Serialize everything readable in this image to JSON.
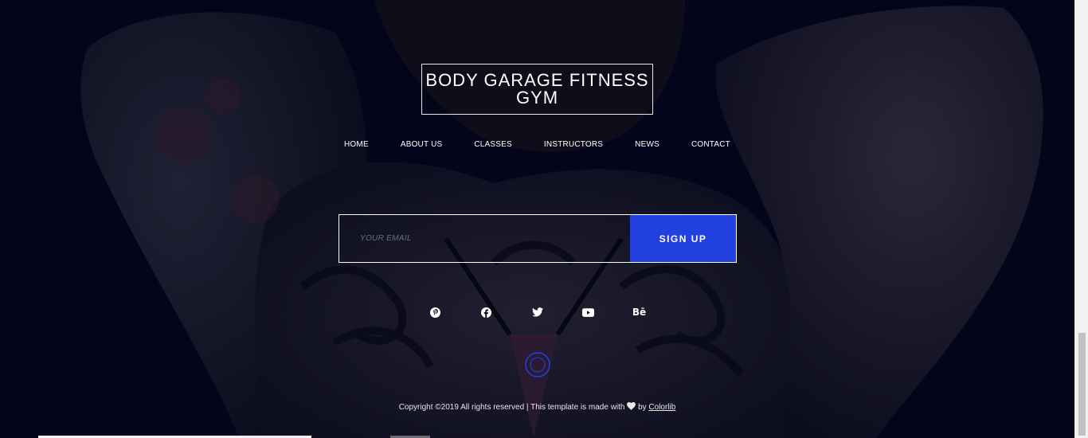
{
  "brand": {
    "title": "BODY GARAGE FITNESS GYM"
  },
  "nav": {
    "items": [
      "HOME",
      "ABOUT US",
      "CLASSES",
      "INSTRUCTORS",
      "NEWS",
      "CONTACT"
    ]
  },
  "signup": {
    "placeholder": "YOUR EMAIL",
    "button_label": "SIGN UP"
  },
  "social": {
    "icons": [
      "pinterest-icon",
      "facebook-icon",
      "twitter-icon",
      "youtube-icon",
      "behance-icon"
    ],
    "behance_text": "Bē"
  },
  "footer": {
    "copyright_prefix": "Copyright ©2019 All rights reserved | This template is made with",
    "by_text": "by",
    "link_text": "Colorlib"
  },
  "colors": {
    "accent": "#2340e0",
    "background": "#05071a"
  }
}
